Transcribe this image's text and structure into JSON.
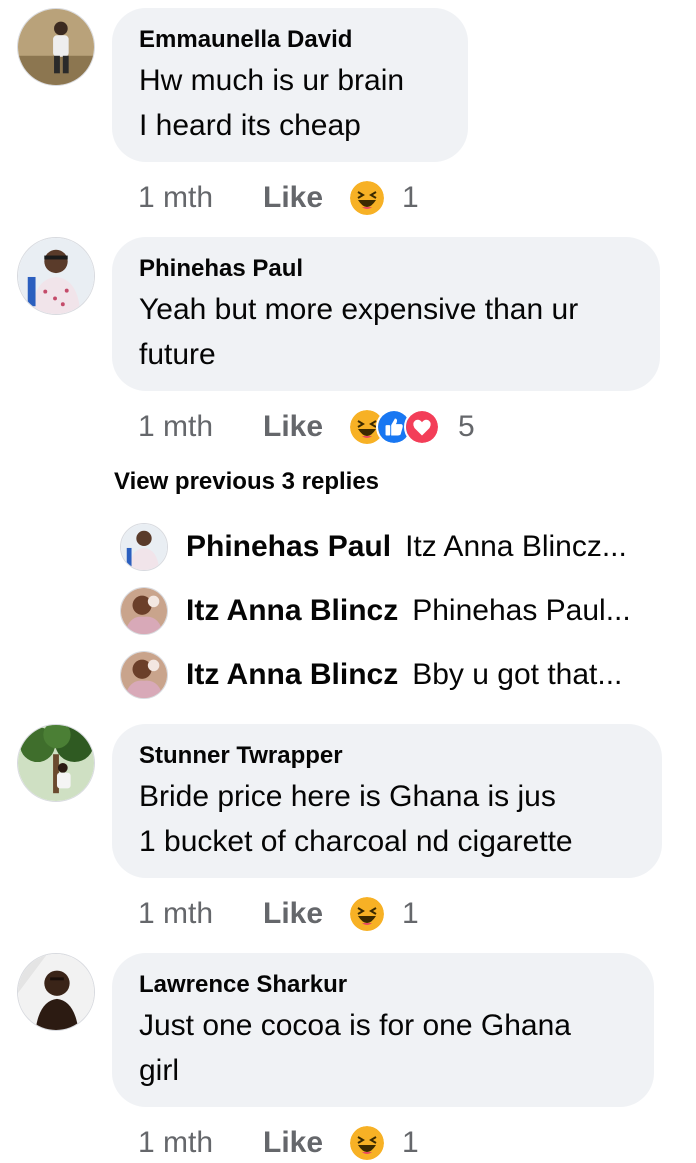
{
  "comments": [
    {
      "author": "Emmaunella David",
      "text": "Hw much is ur brain\nI heard its cheap",
      "time": "1 mth",
      "like": "Like",
      "reactions": [
        "haha"
      ],
      "reaction_count": "1",
      "avatar_icon": "user-avatar"
    },
    {
      "author": "Phinehas Paul",
      "text": "Yeah but more expensive than ur\nfuture",
      "time": "1 mth",
      "like": "Like",
      "reactions": [
        "haha",
        "like",
        "love"
      ],
      "reaction_count": "5",
      "avatar_icon": "user-avatar"
    },
    {
      "author": "Stunner Twrapper",
      "text": "Bride price here is Ghana is jus\n1 bucket of charcoal nd cigarette",
      "time": "1 mth",
      "like": "Like",
      "reactions": [
        "haha"
      ],
      "reaction_count": "1",
      "avatar_icon": "user-avatar"
    },
    {
      "author": "Lawrence Sharkur",
      "text": "Just one cocoa is for one Ghana\ngirl",
      "time": "1 mth",
      "like": "Like",
      "reactions": [
        "haha"
      ],
      "reaction_count": "1",
      "avatar_icon": "user-avatar"
    }
  ],
  "view_previous": "View previous 3 replies",
  "replies": [
    {
      "author": "Phinehas Paul",
      "text": "Itz Anna Blincz..."
    },
    {
      "author": "Itz Anna Blincz",
      "text": "Phinehas Paul..."
    },
    {
      "author": "Itz Anna Blincz",
      "text": "Bby u got that..."
    }
  ],
  "colors": {
    "bubble": "#f0f2f5",
    "meta_text": "#65676b",
    "haha": "#f7b125",
    "like": "#1877f2",
    "love": "#f33e58"
  }
}
